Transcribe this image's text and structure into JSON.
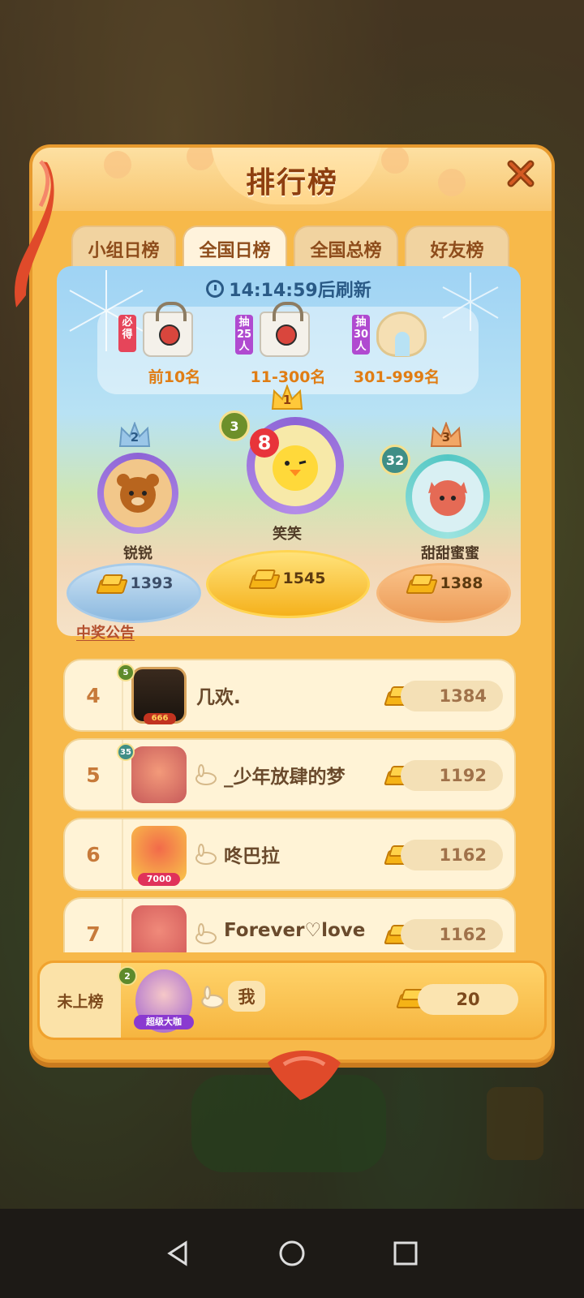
{
  "panel": {
    "title": "排行榜",
    "close_icon": "close-icon"
  },
  "tabs": [
    {
      "label": "小组日榜",
      "active": false
    },
    {
      "label": "全国日榜",
      "active": true
    },
    {
      "label": "全国总榜",
      "active": false
    },
    {
      "label": "好友榜",
      "active": false
    }
  ],
  "refresh": {
    "icon": "clock-icon",
    "text": "14:14:59后刷新"
  },
  "prizes": [
    {
      "tag": "必得",
      "item": "tote-bag-icon",
      "label": "前10名"
    },
    {
      "tag": "抽25人",
      "item": "tote-bag-icon",
      "label": "11-300名"
    },
    {
      "tag": "抽30人",
      "item": "neck-pillow-icon",
      "label": "301-999名"
    }
  ],
  "top3": [
    {
      "crown_rank": "2",
      "name": "锐锐",
      "score": "1393"
    },
    {
      "crown_rank": "1",
      "level": "3",
      "badge": "8",
      "name": "笑笑",
      "score": "1545"
    },
    {
      "crown_rank": "3",
      "level": "32",
      "name": "甜甜蜜蜜",
      "score": "1388"
    }
  ],
  "announcement": "中奖公告",
  "rows": [
    {
      "rank": "4",
      "level": "5",
      "name": "几欢.",
      "score": "1384",
      "avatar_caption": "666"
    },
    {
      "rank": "5",
      "level": "35",
      "name": "_少年放肆的梦",
      "score": "1192"
    },
    {
      "rank": "6",
      "name": "咚巴拉",
      "score": "1162",
      "avatar_caption": "7000"
    },
    {
      "rank": "7",
      "name": "Forever♡love",
      "score": "1162"
    }
  ],
  "me": {
    "rank_label": "未上榜",
    "level": "2",
    "avatar_caption": "超级大咖",
    "name": "我",
    "score": "20"
  },
  "colors": {
    "panel": "#f7b94a",
    "title": "#8e3f10",
    "accent_gold": "#f5b316"
  }
}
